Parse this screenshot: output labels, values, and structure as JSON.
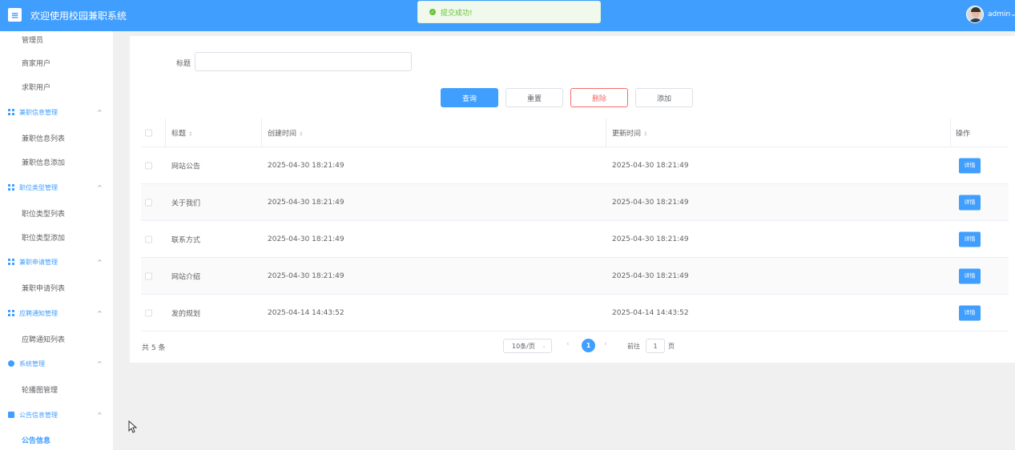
{
  "header": {
    "menu_icon": "menu-icon",
    "title": "欢迎使用校园兼职系统",
    "toast": "提交成功!",
    "username": "admin",
    "user_caret": "⌄"
  },
  "sidebar": {
    "items_top": [
      {
        "label": "管理员"
      },
      {
        "label": "商家用户"
      },
      {
        "label": "求职用户"
      }
    ],
    "groups": [
      {
        "label": "兼职信息管理",
        "icon": "grid-icon",
        "items": [
          "兼职信息列表",
          "兼职信息添加"
        ]
      },
      {
        "label": "职位类型管理",
        "icon": "grid-icon",
        "items": [
          "职位类型列表",
          "职位类型添加"
        ]
      },
      {
        "label": "兼职申请管理",
        "icon": "grid-icon",
        "items": [
          "兼职申请列表"
        ]
      },
      {
        "label": "应聘通知管理",
        "icon": "grid-icon",
        "items": [
          "应聘通知列表"
        ]
      },
      {
        "label": "系统管理",
        "icon": "gear-icon",
        "items": [
          "轮播图管理"
        ]
      },
      {
        "label": "公告信息管理",
        "icon": "document-icon",
        "items": [
          "公告信息"
        ]
      }
    ],
    "chevron": "^"
  },
  "search": {
    "label": "标题",
    "value": "",
    "placeholder": ""
  },
  "toolbar": {
    "query": "查询",
    "reset": "重置",
    "delete": "删除",
    "add": "添加"
  },
  "table": {
    "headers": {
      "title": "标题",
      "created": "创建时间",
      "updated": "更新时间",
      "action": "操作"
    },
    "sort_glyph": "⇕",
    "detail_label": "详情",
    "rows": [
      {
        "title": "网站公告",
        "created": "2025-04-30 18:21:49",
        "updated": "2025-04-30 18:21:49"
      },
      {
        "title": "关于我们",
        "created": "2025-04-30 18:21:49",
        "updated": "2025-04-30 18:21:49"
      },
      {
        "title": "联系方式",
        "created": "2025-04-30 18:21:49",
        "updated": "2025-04-30 18:21:49"
      },
      {
        "title": "网站介绍",
        "created": "2025-04-30 18:21:49",
        "updated": "2025-04-30 18:21:49"
      },
      {
        "title": "发的规划",
        "created": "2025-04-14 14:43:52",
        "updated": "2025-04-14 14:43:52"
      }
    ]
  },
  "pagination": {
    "total": "共 5 条",
    "page_size": "10条/页",
    "prev": "‹",
    "current_page": "1",
    "next": "›",
    "goto_label": "前往",
    "goto_value": "1",
    "goto_suffix": "页"
  },
  "colors": {
    "primary": "#409eff",
    "danger": "#f56c6c",
    "success": "#67c23a"
  }
}
